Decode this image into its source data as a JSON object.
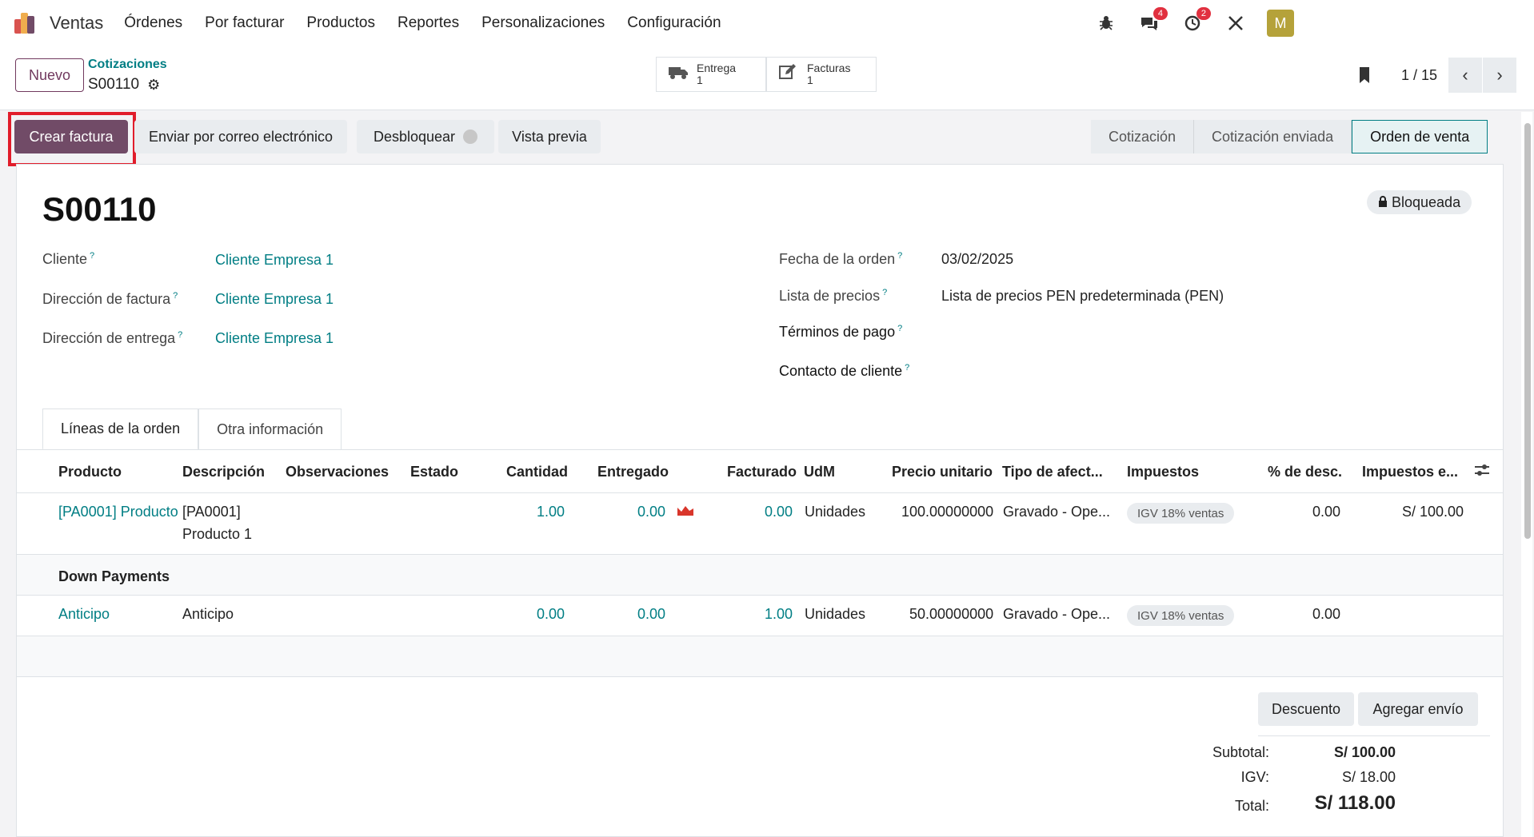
{
  "nav": {
    "app_name": "Ventas",
    "menu": [
      "Órdenes",
      "Por facturar",
      "Productos",
      "Reportes",
      "Personalizaciones",
      "Configuración"
    ],
    "messages_count": "4",
    "activities_count": "2",
    "avatar_letter": "M"
  },
  "control": {
    "new_label": "Nuevo",
    "breadcrumb": "Cotizaciones",
    "record": "S00110",
    "smart_delivery_label": "Entrega",
    "smart_delivery_count": "1",
    "smart_invoices_label": "Facturas",
    "smart_invoices_count": "1",
    "pager": "1 / 15"
  },
  "actions": {
    "create_invoice": "Crear factura",
    "send_email": "Enviar por correo electrónico",
    "unlock": "Desbloquear",
    "preview": "Vista previa"
  },
  "status": {
    "stages": [
      "Cotización",
      "Cotización enviada",
      "Orden de venta"
    ],
    "active": "Orden de venta"
  },
  "form": {
    "title": "S00110",
    "locked_label": "Bloqueada",
    "left": [
      {
        "label": "Cliente",
        "value": "Cliente Empresa 1"
      },
      {
        "label": "Dirección de factura",
        "value": "Cliente Empresa 1"
      },
      {
        "label": "Dirección de entrega",
        "value": "Cliente Empresa 1"
      }
    ],
    "right": [
      {
        "label": "Fecha de la orden",
        "value": "03/02/2025"
      },
      {
        "label": "Lista de precios",
        "value": "Lista de precios PEN predeterminada (PEN)"
      },
      {
        "label": "Términos de pago",
        "value": ""
      },
      {
        "label": "Contacto de cliente",
        "value": ""
      }
    ]
  },
  "tabs": [
    "Líneas de la orden",
    "Otra información"
  ],
  "table": {
    "headers": [
      "Producto",
      "Descripción",
      "Observaciones",
      "Estado",
      "Cantidad",
      "Entregado",
      "Facturado",
      "UdM",
      "Precio unitario",
      "Tipo de afect...",
      "Impuestos",
      "% de desc.",
      "Impuestos e..."
    ],
    "rows": [
      {
        "product": "[PA0001] Producto 1",
        "desc1": "[PA0001]",
        "desc2": "Producto 1",
        "qty": "1.00",
        "delivered": "0.00",
        "invoiced": "0.00",
        "uom": "Unidades",
        "price": "100.00000000",
        "affect": "Gravado - Ope...",
        "tax": "IGV 18% ventas",
        "discount": "0.00",
        "tax_incl": "S/ 100.00"
      },
      {
        "product": "Anticipo",
        "desc1": "Anticipo",
        "qty": "0.00",
        "delivered": "0.00",
        "invoiced": "1.00",
        "uom": "Unidades",
        "price": "50.00000000",
        "affect": "Gravado - Ope...",
        "tax": "IGV 18% ventas",
        "discount": "0.00"
      }
    ],
    "section": "Down Payments"
  },
  "footer": {
    "discount_btn": "Descuento",
    "shipping_btn": "Agregar envío",
    "subtotal_label": "Subtotal:",
    "subtotal": "S/ 100.00",
    "igv_label": "IGV:",
    "igv": "S/ 18.00",
    "total_label": "Total:",
    "total": "S/ 118.00"
  },
  "colors": {
    "brand": "#714b67",
    "link": "#017e84",
    "highlight": "#e11d2b"
  }
}
